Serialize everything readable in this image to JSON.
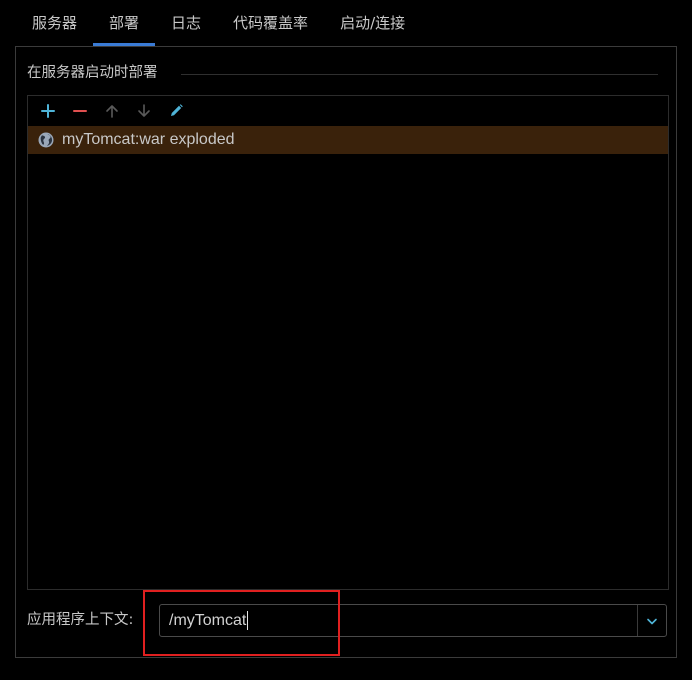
{
  "tabs": [
    {
      "label": "服务器"
    },
    {
      "label": "部署"
    },
    {
      "label": "日志"
    },
    {
      "label": "代码覆盖率"
    },
    {
      "label": "启动/连接"
    }
  ],
  "active_tab": "部署",
  "deploy_group": {
    "title": "在服务器启动时部署",
    "toolbar": {
      "add_icon": "plus-icon",
      "remove_icon": "minus-icon",
      "move_up_icon": "arrow-up-icon",
      "move_down_icon": "arrow-down-icon",
      "edit_icon": "pencil-icon"
    },
    "items": [
      {
        "label": "myTomcat:war exploded",
        "icon": "globe-icon",
        "selected": true
      }
    ]
  },
  "context": {
    "label": "应用程序上下文:",
    "value": "/myTomcat"
  },
  "colors": {
    "accent": "#3a7bd5",
    "selection": "#3a220b",
    "add": "#4fb4d8",
    "remove": "#e05050",
    "highlight": "#e02020"
  }
}
